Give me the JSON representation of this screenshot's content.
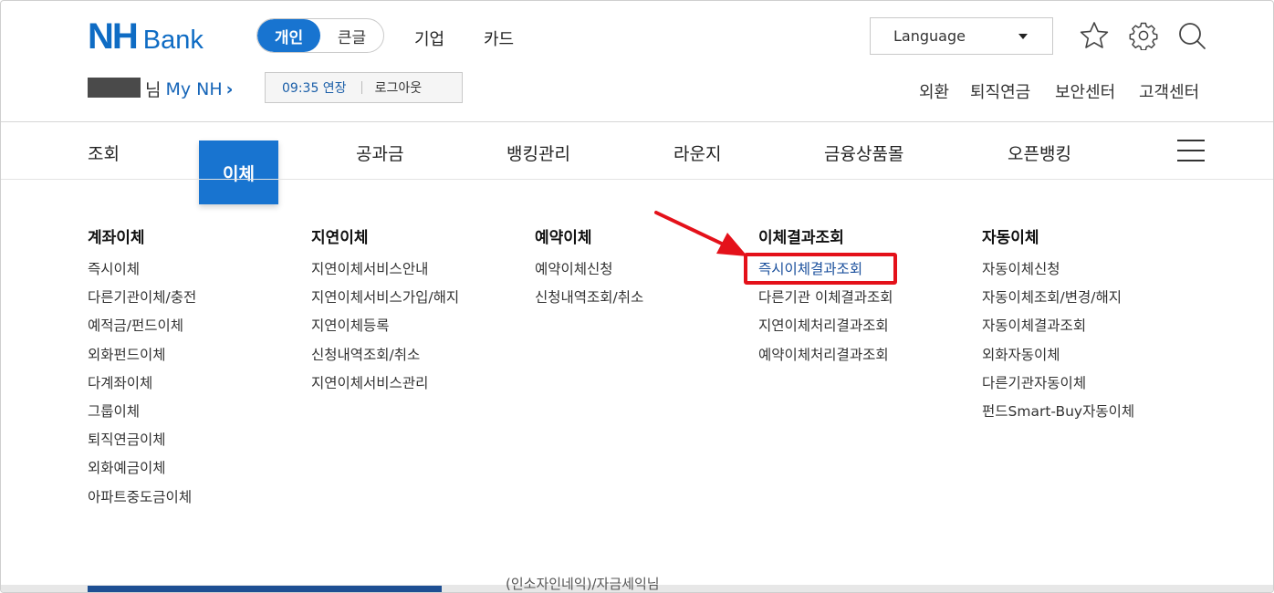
{
  "brand": {
    "logo_mark": "NH",
    "logo_word": "Bank",
    "accent": "#1874d0"
  },
  "segment": {
    "active": "개인",
    "other": "큰글"
  },
  "top_links": [
    "기업",
    "카드"
  ],
  "language": {
    "label": "Language"
  },
  "header_icons": [
    "star-icon",
    "gear-icon",
    "search-icon"
  ],
  "user": {
    "suffix": "님",
    "my_link": "My NH",
    "chevron": "›"
  },
  "session": {
    "time": "09:35 연장",
    "logout": "로그아웃"
  },
  "utility_links": [
    "외환",
    "퇴직연금",
    "보안센터",
    "고객센터"
  ],
  "gnb": {
    "items": [
      "조회",
      "이체",
      "공과금",
      "뱅킹관리",
      "라운지",
      "금융상품몰",
      "오픈뱅킹"
    ],
    "active": "이체"
  },
  "menu": {
    "columns": [
      {
        "title": "계좌이체",
        "items": [
          "즉시이체",
          "다른기관이체/충전",
          "예적금/펀드이체",
          "외화펀드이체",
          "다계좌이체",
          "그룹이체",
          "퇴직연금이체",
          "외화예금이체",
          "아파트중도금이체"
        ]
      },
      {
        "title": "지연이체",
        "items": [
          "지연이체서비스안내",
          "지연이체서비스가입/해지",
          "지연이체등록",
          "신청내역조회/취소",
          "지연이체서비스관리"
        ]
      },
      {
        "title": "예약이체",
        "items": [
          "예약이체신청",
          "신청내역조회/취소"
        ]
      },
      {
        "title": "이체결과조회",
        "items": [
          "즉시이체결과조회",
          "다른기관 이체결과조회",
          "지연이체처리결과조회",
          "예약이체처리결과조회"
        ]
      },
      {
        "title": "자동이체",
        "items": [
          "자동이체신청",
          "자동이체조회/변경/해지",
          "자동이체결과조회",
          "외화자동이체",
          "다른기관자동이체",
          "펀드Smart-Buy자동이체"
        ]
      }
    ],
    "highlighted": "즉시이체결과조회",
    "highlight_color": "#e4111a"
  },
  "bottom_peek": {
    "text": "(인소자인네익)/자금세익님"
  }
}
